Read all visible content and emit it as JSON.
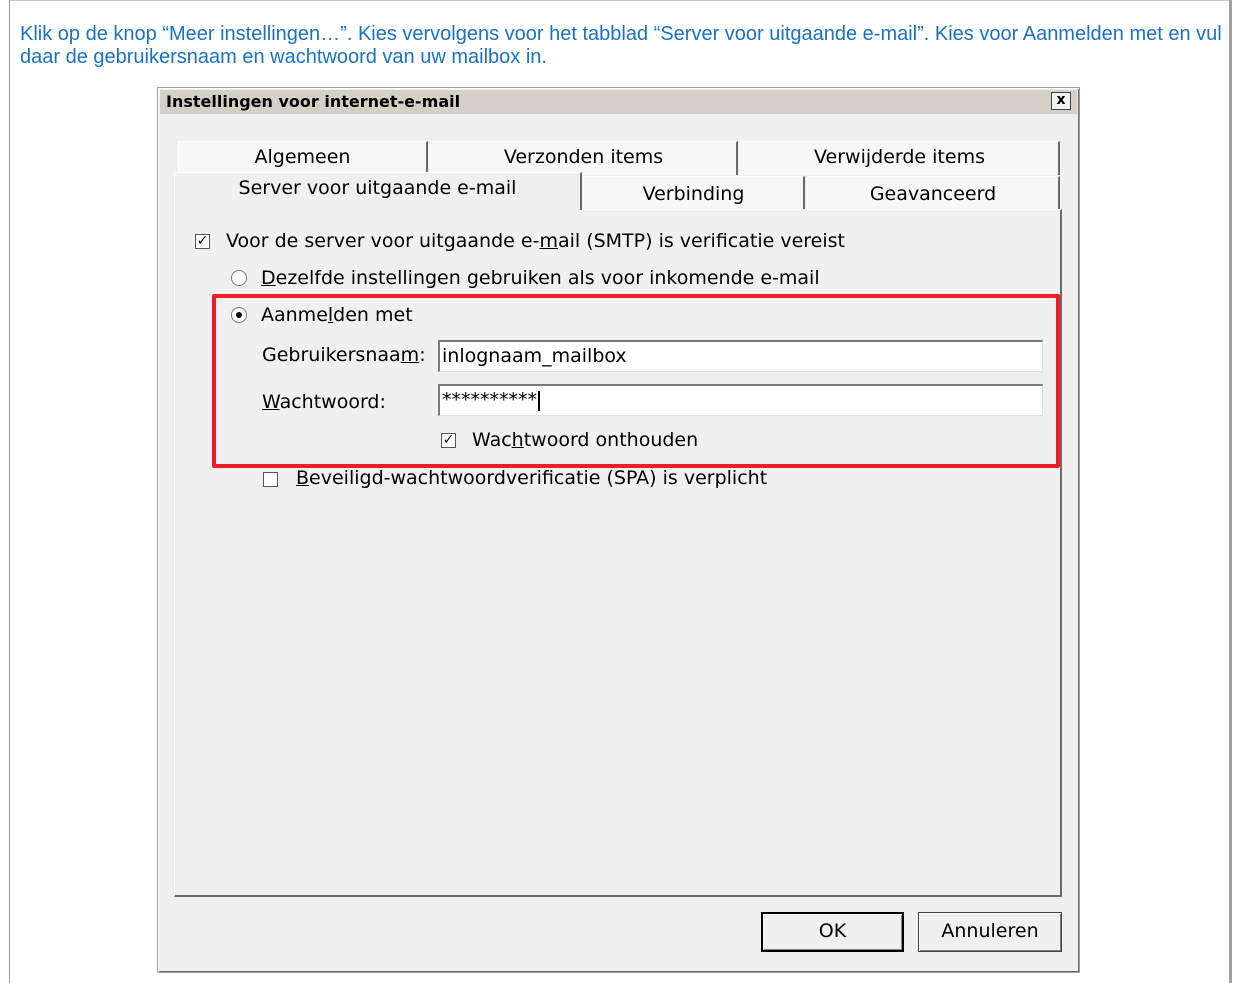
{
  "instruction": "Klik op de knop “Meer instellingen…”. Kies vervolgens voor het tabblad “Server voor uitgaande e-mail”. Kies voor Aanmelden met en vul daar de gebruikersnaam en wachtwoord van uw mailbox in.",
  "dialog": {
    "title": "Instellingen voor internet-e-mail",
    "close_label": "x"
  },
  "tabs": {
    "row_back": [
      "Algemeen",
      "Verzonden items",
      "Verwijderde items"
    ],
    "row_front": [
      "Server voor uitgaande e-mail",
      "Verbinding",
      "Geavanceerd"
    ],
    "active": "Server voor uitgaande e-mail"
  },
  "panel": {
    "smtp_auth": {
      "label_pre": "Voor de server voor uitgaande e-",
      "label_accel": "m",
      "label_post": "ail (SMTP) is verificatie vereist",
      "checked": true
    },
    "same_settings": {
      "label_accel": "D",
      "label_post": "ezelfde instellingen gebruiken als voor inkomende e-mail",
      "selected": false
    },
    "login_with": {
      "label_pre": "Aanme",
      "label_accel": "l",
      "label_post": "den met",
      "selected": true
    },
    "username": {
      "label_pre": "Gebruikersnaa",
      "label_accel": "m",
      "label_post": ":",
      "value": "inlognaam_mailbox"
    },
    "password": {
      "label_accel": "W",
      "label_post": "achtwoord:",
      "value": "**********"
    },
    "remember_password": {
      "label_pre": "Wac",
      "label_accel": "h",
      "label_post": "twoord onthouden",
      "checked": true
    },
    "spa": {
      "label_accel": "B",
      "label_post": "eveiligd-wachtwoordverificatie (SPA) is verplicht",
      "checked": false
    }
  },
  "buttons": {
    "ok": "OK",
    "cancel": "Annuleren"
  },
  "colors": {
    "instruction_text": "#1a73c1",
    "highlight": "#ee1c24"
  },
  "icons": {
    "check": "check-icon",
    "close": "close-icon"
  }
}
